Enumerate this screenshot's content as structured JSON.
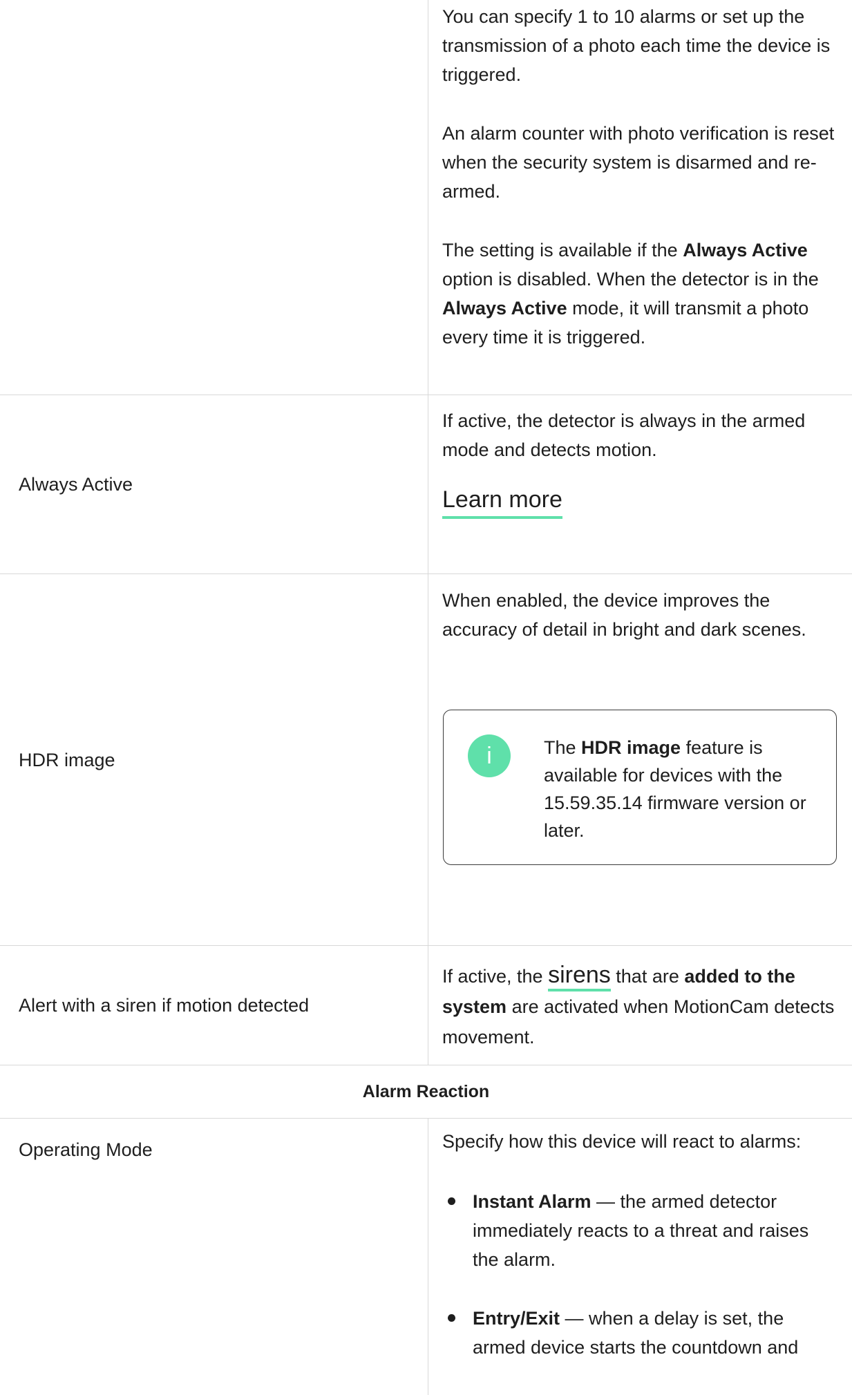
{
  "rows": {
    "alarms": {
      "p1": "You can specify 1 to 10 alarms or set up the transmission of a photo each time the device is triggered.",
      "p2": "An alarm counter with photo verification is reset when the security system is disarmed and re-armed.",
      "p3_a": "The setting is available if the ",
      "p3_b": "Always Active",
      "p3_c": " option is disabled. When the detector is in the ",
      "p3_d": "Always Active",
      "p3_e": " mode, it will transmit a photo every time it is triggered."
    },
    "always_active": {
      "label": "Always Active",
      "desc": "If active, the detector is always in the armed mode and detects motion.",
      "link": "Learn more"
    },
    "hdr": {
      "label": "HDR image",
      "desc": "When enabled, the device improves the accuracy of detail in bright and dark scenes.",
      "note_icon": "i",
      "note_a": "The ",
      "note_b": "HDR image",
      "note_c": " feature is available for devices with the 15.59.35.14 firmware version or later."
    },
    "siren": {
      "label": "Alert with a siren if motion detected",
      "desc_a": "If active, the ",
      "desc_link": "sirens",
      "desc_b": " that are ",
      "desc_bold": "added to the system",
      "desc_c": " are activated when MotionCam detects movement."
    },
    "section": {
      "heading": "Alarm Reaction"
    },
    "operating_mode": {
      "label": "Operating Mode",
      "desc": "Specify how this device will react to alarms:",
      "items": [
        {
          "term": "Instant Alarm",
          "text": " — the armed detector immediately reacts to a threat and raises the alarm."
        },
        {
          "term": "Entry/Exit",
          "text": " — when a delay is set, the armed device starts the countdown and"
        }
      ]
    }
  }
}
